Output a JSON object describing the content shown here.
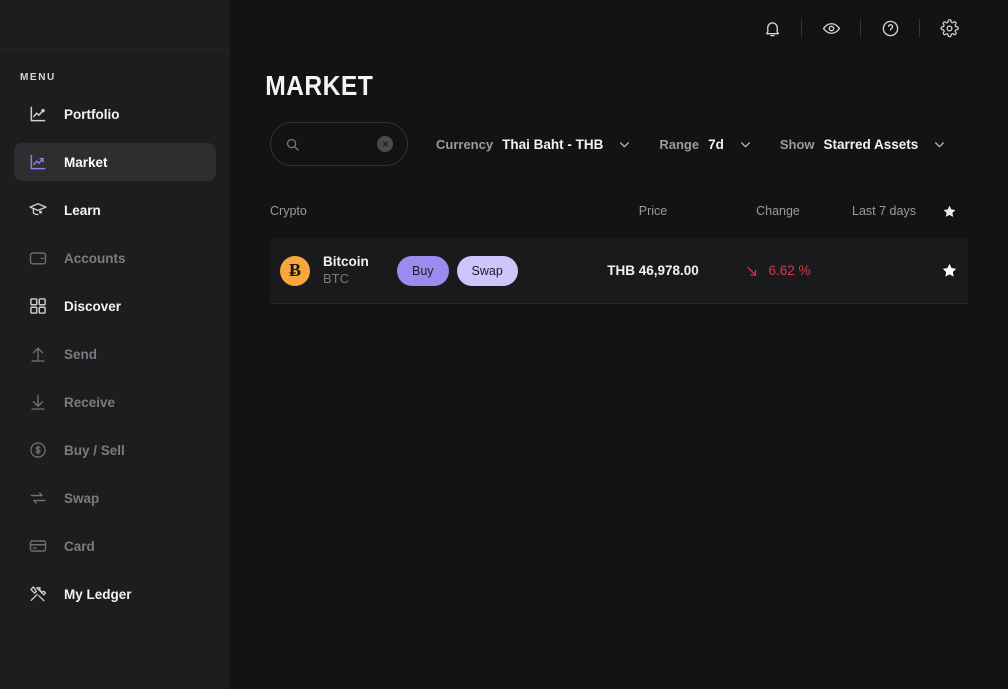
{
  "sidebar": {
    "menu_label": "MENU",
    "items": [
      {
        "label": "Portfolio",
        "icon": "chart-line-icon",
        "state": "bright"
      },
      {
        "label": "Market",
        "icon": "chart-trend-icon",
        "state": "active"
      },
      {
        "label": "Learn",
        "icon": "graduation-cap-icon",
        "state": "bright"
      },
      {
        "label": "Accounts",
        "icon": "wallet-icon",
        "state": "dim"
      },
      {
        "label": "Discover",
        "icon": "grid-apps-icon",
        "state": "bright"
      },
      {
        "label": "Send",
        "icon": "arrow-up-icon",
        "state": "dim"
      },
      {
        "label": "Receive",
        "icon": "arrow-down-icon",
        "state": "dim"
      },
      {
        "label": "Buy / Sell",
        "icon": "dollar-circle-icon",
        "state": "dim"
      },
      {
        "label": "Swap",
        "icon": "swap-arrows-icon",
        "state": "dim"
      },
      {
        "label": "Card",
        "icon": "credit-card-icon",
        "state": "dim"
      },
      {
        "label": "My Ledger",
        "icon": "tools-icon",
        "state": "bright"
      }
    ]
  },
  "topbar": {
    "icons": [
      {
        "name": "bell-icon"
      },
      {
        "name": "eye-icon"
      },
      {
        "name": "help-circle-icon"
      },
      {
        "name": "gear-icon"
      }
    ]
  },
  "page": {
    "title": "MARKET"
  },
  "search": {
    "value": "",
    "placeholder": "",
    "icon": "search-icon",
    "clear_icon": "close-circle-icon"
  },
  "filters": [
    {
      "label": "Currency",
      "value": "Thai Baht - THB",
      "name": "currency"
    },
    {
      "label": "Range",
      "value": "7d",
      "name": "range"
    },
    {
      "label": "Show",
      "value": "Starred Assets",
      "name": "show"
    }
  ],
  "table": {
    "columns": {
      "crypto": "Crypto",
      "price": "Price",
      "change": "Change",
      "last_days": "Last 7 days",
      "star": "star-icon"
    },
    "rows": [
      {
        "coin_symbol": "Ƀ",
        "coin_name": "Bitcoin",
        "coin_ticker": "BTC",
        "buy_label": "Buy",
        "swap_label": "Swap",
        "price": "THB 46,978.00",
        "change": "6.62 %",
        "change_direction": "down",
        "starred": true
      }
    ]
  },
  "colors": {
    "accent_purple": "#8f7ae8",
    "buy_button": "#9c8bef",
    "swap_button": "#cfc5fb",
    "bitcoin_orange": "#f7a73b",
    "change_negative": "#e3344d",
    "sidebar_bg": "#1d1d1f",
    "main_bg": "#131315",
    "row_bg": "#1a1a1c"
  }
}
